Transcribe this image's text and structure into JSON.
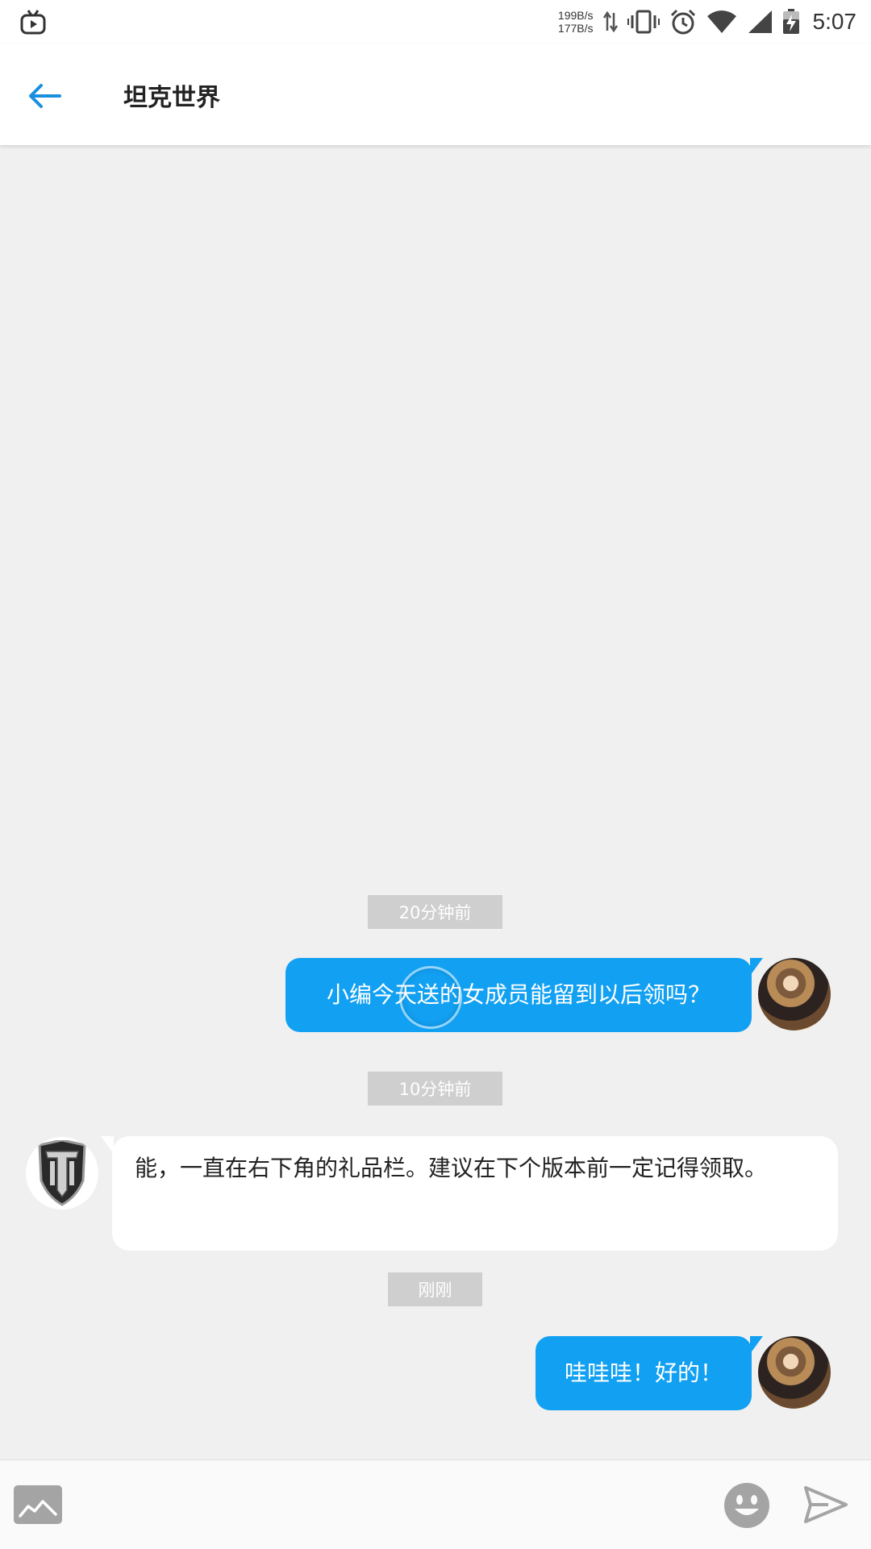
{
  "status_bar": {
    "net_up": "199B/s",
    "net_down": "177B/s",
    "time": "5:07"
  },
  "header": {
    "title": "坦克世界"
  },
  "messages": [
    {
      "timestamp": "20分钟前",
      "direction": "out",
      "text": "小编今天送的女成员能留到以后领吗？"
    },
    {
      "timestamp": "10分钟前",
      "direction": "in",
      "text": "能，一直在右下角的礼品栏。建议在下个版本前一定记得领取。"
    },
    {
      "timestamp": "刚刚",
      "direction": "out",
      "text": "哇哇哇！好的！"
    }
  ],
  "colors": {
    "accent": "#12a0f2",
    "background": "#f0f0f0",
    "timestamp_bg": "#cfcfcf"
  },
  "icons": {
    "back": "arrow-left-icon",
    "image": "image-icon",
    "emoji": "emoji-icon",
    "send": "send-icon"
  }
}
